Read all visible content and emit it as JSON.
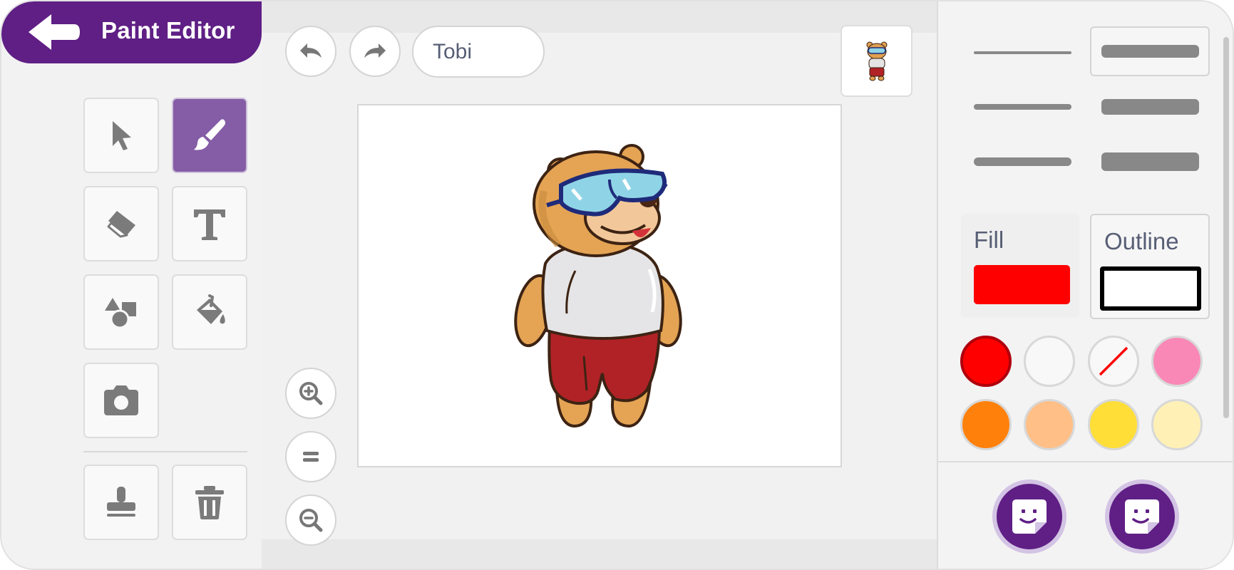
{
  "header": {
    "title": "Paint Editor",
    "back_icon": "arrow-left-icon"
  },
  "tools": [
    {
      "name": "select",
      "icon": "cursor-arrow-icon",
      "active": false
    },
    {
      "name": "brush",
      "icon": "paintbrush-icon",
      "active": true
    },
    {
      "name": "eraser",
      "icon": "eraser-icon",
      "active": false
    },
    {
      "name": "text",
      "icon": "text-t-icon",
      "active": false
    },
    {
      "name": "shapes",
      "icon": "shapes-icon",
      "active": false
    },
    {
      "name": "fill",
      "icon": "paint-bucket-icon",
      "active": false
    },
    {
      "name": "camera",
      "icon": "camera-icon",
      "active": false
    },
    {
      "name": "stamp",
      "icon": "stamp-icon",
      "active": false
    },
    {
      "name": "delete",
      "icon": "trash-icon",
      "active": false
    }
  ],
  "top_bar": {
    "undo_icon": "undo-icon",
    "redo_icon": "redo-icon",
    "costume_name": "Tobi"
  },
  "zoom": {
    "zoom_in_icon": "zoom-in-icon",
    "reset_icon": "equals-icon",
    "zoom_out_icon": "zoom-out-icon"
  },
  "properties": {
    "fill_label": "Fill",
    "outline_label": "Outline",
    "fill_color": "#ff0000",
    "outline_color": "#000000"
  },
  "palette": [
    {
      "color": "#ff0000",
      "selected": true
    },
    {
      "color": "#f8f8f8",
      "selected": false
    },
    {
      "color": "none",
      "selected": false
    },
    {
      "color": "#f988b7",
      "selected": false
    },
    {
      "color": "#ff800a",
      "selected": false
    },
    {
      "color": "#ffbf86",
      "selected": false
    },
    {
      "color": "#ffde37",
      "selected": false
    },
    {
      "color": "#fff1b5",
      "selected": false
    }
  ],
  "colors": {
    "accent": "#5f1f85",
    "active_tool": "#855ca6"
  }
}
